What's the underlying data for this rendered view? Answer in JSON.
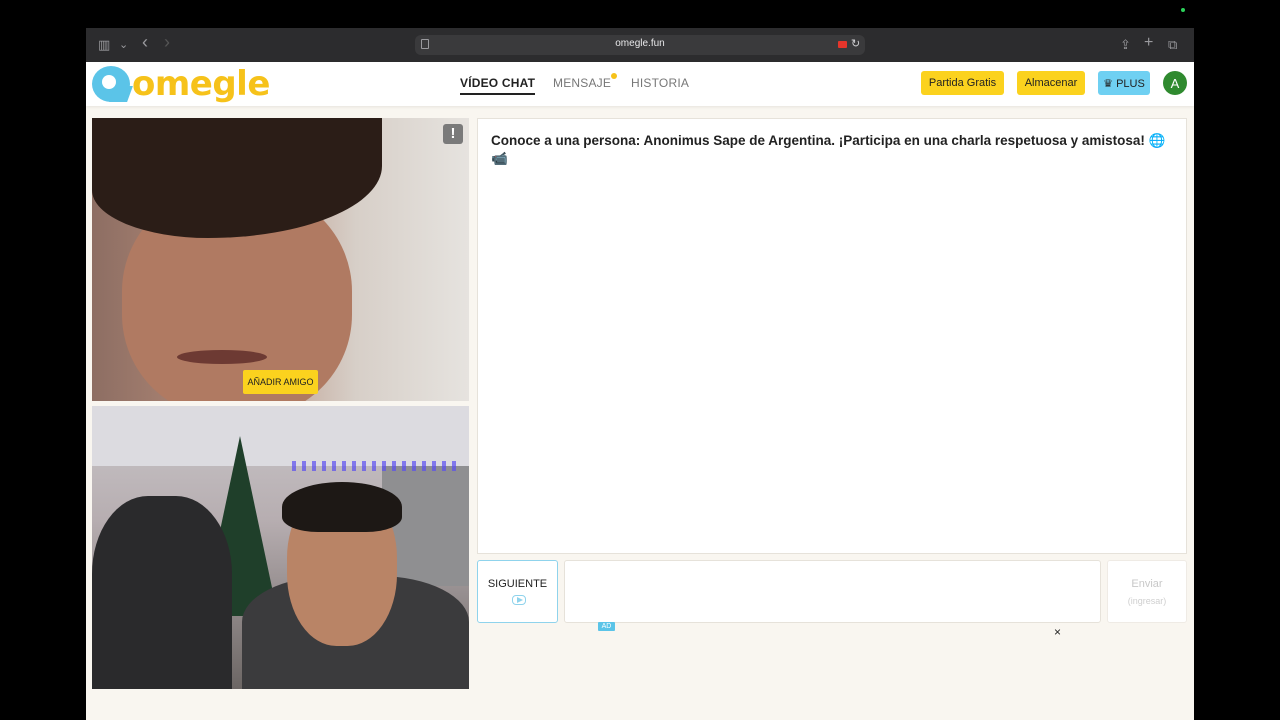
{
  "browser": {
    "url": "omegle.fun",
    "controls": {
      "sidebar": "▥",
      "sidebar_menu": "⌄",
      "back": "‹",
      "forward": "›",
      "share": "⇪",
      "new_tab": "+",
      "tabs": "⧉",
      "reload": "↻"
    }
  },
  "header": {
    "logo_text": "omegle",
    "nav": {
      "video_chat": "VÍDEO CHAT",
      "message": "MENSAJE",
      "history": "HISTORIA"
    },
    "buttons": {
      "free_game": "Partida Gratis",
      "store": "Almacenar",
      "plus": "♛ PLUS"
    },
    "avatar_initial": "A"
  },
  "video": {
    "report_icon": "!",
    "add_friend": "AÑADIR AMIGO"
  },
  "chat": {
    "intro_message": "Conoce a una persona: Anonimus Sape de Argentina. ¡Participa en una charla respetuosa y amistosa! 🌐 📹",
    "next_label": "SIGUIENTE",
    "send_label": "Enviar",
    "send_hint": "(ingresar)",
    "ad_badge": "AD",
    "close_ad": "×"
  },
  "colors": {
    "brand_yellow": "#fbd21e",
    "brand_blue": "#5bc4e8",
    "avatar_green": "#2f8a2f"
  }
}
